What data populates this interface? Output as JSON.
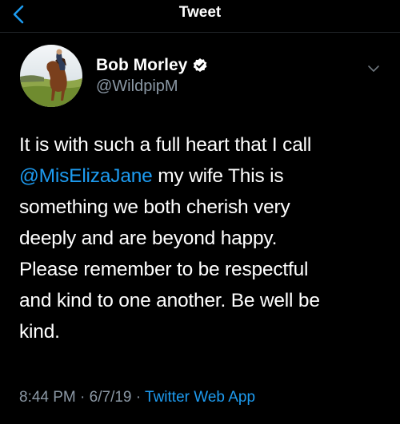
{
  "header": {
    "title": "Tweet",
    "back_icon": "chevron-left-icon"
  },
  "author": {
    "display_name": "Bob Morley",
    "handle": "@WildpipM",
    "verified": true
  },
  "tweet": {
    "line1": "It is with such a full heart that I call",
    "mention": "@MisElizaJane",
    "line2_rest": " my wife This is",
    "line3": "something we both cherish very",
    "line4": "deeply and are beyond happy.",
    "line5": "Please remember to be respectful",
    "line6": "and kind to one another. Be well be",
    "line7": "kind."
  },
  "meta": {
    "time": "8:44 PM",
    "sep1": " · ",
    "date": "6/7/19",
    "sep2": " · ",
    "source": "Twitter Web App"
  },
  "colors": {
    "background": "#000000",
    "accent": "#1d9bf0",
    "secondary_text": "#8b98a5"
  }
}
